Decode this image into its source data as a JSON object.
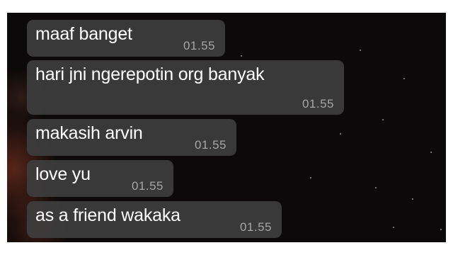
{
  "chat": {
    "messages": [
      {
        "text": "maaf banget",
        "time": "01.55"
      },
      {
        "text": "hari jni ngerepotin org banyak",
        "time": "01.55"
      },
      {
        "text": "makasih arvin",
        "time": "01.55"
      },
      {
        "text": "love yu",
        "time": "01.55"
      },
      {
        "text": "as a friend wakaka",
        "time": "01.55"
      }
    ]
  }
}
